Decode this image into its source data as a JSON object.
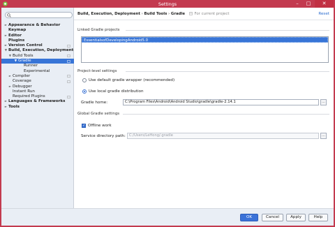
{
  "window": {
    "title": "Settings",
    "controls": [
      "–",
      "□",
      "✕"
    ]
  },
  "search": {
    "value": "",
    "placeholder": ""
  },
  "sidebar": {
    "items": [
      {
        "label": "Appearance & Behavior",
        "bold": true,
        "arrow": "►",
        "level": 0
      },
      {
        "label": "Keymap",
        "bold": true,
        "arrow": "",
        "level": 0
      },
      {
        "label": "Editor",
        "bold": true,
        "arrow": "►",
        "level": 0
      },
      {
        "label": "Plugins",
        "bold": true,
        "arrow": "",
        "level": 0
      },
      {
        "label": "Version Control",
        "bold": true,
        "arrow": "►",
        "level": 0,
        "cfg": true
      },
      {
        "label": "Build, Execution, Deployment",
        "bold": true,
        "arrow": "▼",
        "level": 0
      },
      {
        "label": "Build Tools",
        "bold": false,
        "arrow": "▼",
        "level": 1,
        "cfg": true
      },
      {
        "label": "Gradle",
        "bold": false,
        "arrow": "▼",
        "level": 2,
        "cfg": true,
        "selected": true
      },
      {
        "label": "Runner",
        "bold": false,
        "arrow": "",
        "level": 3
      },
      {
        "label": "Experimental",
        "bold": false,
        "arrow": "",
        "level": 3
      },
      {
        "label": "Compiler",
        "bold": false,
        "arrow": "►",
        "level": 1,
        "cfg": true
      },
      {
        "label": "Coverage",
        "bold": false,
        "arrow": "",
        "level": 1,
        "cfg": true
      },
      {
        "label": "Debugger",
        "bold": false,
        "arrow": "►",
        "level": 1
      },
      {
        "label": "Instant Run",
        "bold": false,
        "arrow": "",
        "level": 1
      },
      {
        "label": "Required Plugins",
        "bold": false,
        "arrow": "",
        "level": 1,
        "cfg": true
      },
      {
        "label": "Languages & Frameworks",
        "bold": true,
        "arrow": "►",
        "level": 0
      },
      {
        "label": "Tools",
        "bold": true,
        "arrow": "►",
        "level": 0
      }
    ]
  },
  "breadcrumb": {
    "path": "Build, Execution, Deployment",
    "sep1": "›",
    "part2": "Build Tools",
    "sep2": "›",
    "part3": "Gradle",
    "scope": "For current project"
  },
  "reset_label": "Reset",
  "linked": {
    "title": "Linked Gradle projects",
    "projects": [
      "EssentialsofDevelopingAndroid5.0"
    ]
  },
  "project_settings": {
    "title": "Project-level settings",
    "option_wrapper": "Use default gradle wrapper (recommended)",
    "option_local": "Use local gradle distribution",
    "gradle_home_label": "Gradle home:",
    "gradle_home_value": "C:\\Program Files\\Android\\Android Studio\\gradle\\gradle-2.14.1"
  },
  "global_settings": {
    "title": "Global Gradle settings",
    "offline_label": "Offline work",
    "service_dir_label": "Service directory path:",
    "service_dir_value": "C:/Users/LeHong/.gradle"
  },
  "browse_label": "...",
  "footer": {
    "ok": "OK",
    "cancel": "Cancel",
    "apply": "Apply",
    "help": "Help"
  },
  "colors": {
    "titlebar": "#c33a4f",
    "selection": "#3875d7",
    "link": "#2a6ccf"
  }
}
